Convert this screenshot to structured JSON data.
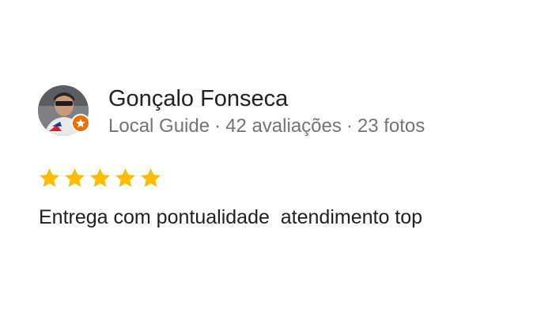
{
  "review": {
    "author": {
      "name": "Gonçalo Fonseca",
      "badge": "Local Guide",
      "reviews_count": "42 avaliações",
      "photos_count": "23 fotos",
      "separator": "·"
    },
    "rating": {
      "stars": 5,
      "max": 5,
      "color": "#fbbc04"
    },
    "text": "Entrega com pontualidade  atendimento top"
  }
}
